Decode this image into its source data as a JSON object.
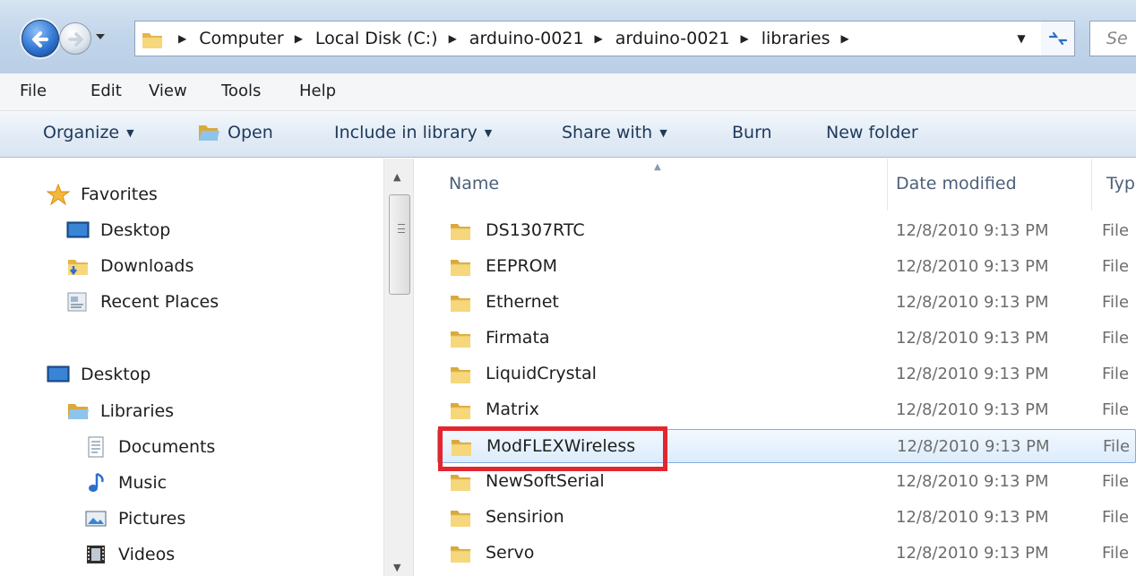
{
  "address_bar": {
    "breadcrumbs": [
      "Computer",
      "Local Disk (C:)",
      "arduino-0021",
      "arduino-0021",
      "libraries"
    ]
  },
  "search": {
    "placeholder": "Se"
  },
  "menu": [
    "File",
    "Edit",
    "View",
    "Tools",
    "Help"
  ],
  "toolbar": {
    "organize": "Organize",
    "open": "Open",
    "include_in_library": "Include in library",
    "share_with": "Share with",
    "burn": "Burn",
    "new_folder": "New folder"
  },
  "nav": {
    "favorites": "Favorites",
    "desktop_fav": "Desktop",
    "downloads": "Downloads",
    "recent_places": "Recent Places",
    "desktop": "Desktop",
    "libraries": "Libraries",
    "documents": "Documents",
    "music": "Music",
    "pictures": "Pictures",
    "videos": "Videos"
  },
  "columns": {
    "name": "Name",
    "date_modified": "Date modified",
    "type": "Typ"
  },
  "files": [
    {
      "name": "DS1307RTC",
      "date": "12/8/2010 9:13 PM",
      "type": "File"
    },
    {
      "name": "EEPROM",
      "date": "12/8/2010 9:13 PM",
      "type": "File"
    },
    {
      "name": "Ethernet",
      "date": "12/8/2010 9:13 PM",
      "type": "File"
    },
    {
      "name": "Firmata",
      "date": "12/8/2010 9:13 PM",
      "type": "File"
    },
    {
      "name": "LiquidCrystal",
      "date": "12/8/2010 9:13 PM",
      "type": "File"
    },
    {
      "name": "Matrix",
      "date": "12/8/2010 9:13 PM",
      "type": "File"
    },
    {
      "name": "ModFLEXWireless",
      "date": "12/8/2010 9:13 PM",
      "type": "File"
    },
    {
      "name": "NewSoftSerial",
      "date": "12/8/2010 9:13 PM",
      "type": "File"
    },
    {
      "name": "Sensirion",
      "date": "12/8/2010 9:13 PM",
      "type": "File"
    },
    {
      "name": "Servo",
      "date": "12/8/2010 9:13 PM",
      "type": "File"
    }
  ],
  "selected_file": "ModFLEXWireless",
  "colors": {
    "highlight": "#e3262e",
    "selection": "#dcecfc"
  }
}
